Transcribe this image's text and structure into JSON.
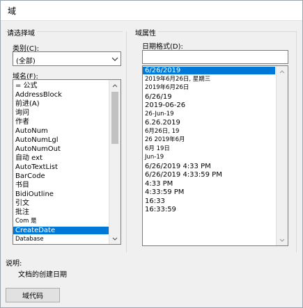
{
  "window": {
    "title": "域"
  },
  "left_group": {
    "title": "请选择域",
    "category_label": "类别(C):",
    "category_value": "(全部)",
    "fieldname_label": "域名(F):",
    "field_names": [
      "= 公式",
      "AddressBlock",
      "前进(A)",
      "询问",
      "作者",
      "AutoNum",
      "AutoNumLgl",
      "AutoNumOut",
      "自动 ext",
      "AutoTextList",
      "BarCode",
      "书目",
      "BidiOutline",
      "引文",
      "批注",
      "Com 是",
      "CreateDate",
      "Database"
    ],
    "selected_field": "CreateDate"
  },
  "right_group": {
    "title": "域属性",
    "date_format_label": "日期格式(D):",
    "date_format_value": "",
    "formats": [
      "6/26/2019",
      "2019年6月26日, 星期三",
      "2019年6月26日",
      "6/26/19",
      "2019-06-26",
      "26-Jun-19",
      "6.26.2019",
      "6月26日, 19",
      "26 2019年6月",
      "6月 19日",
      "Jun-19",
      "6/26/2019 4:33 PM",
      "6/26/2019 4:33:59 PM",
      "4:33 PM",
      "4:33:59 PM",
      "16:33",
      "16:33:59"
    ],
    "selected_format": "6/26/2019"
  },
  "description": {
    "label": "说明:",
    "text": "文档的创建日期"
  },
  "footer": {
    "field_codes_button": "域代码"
  }
}
